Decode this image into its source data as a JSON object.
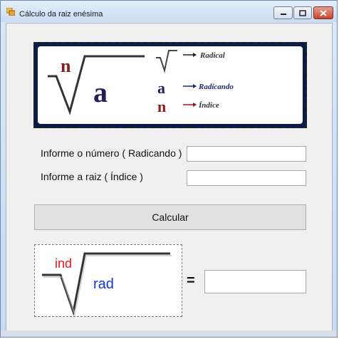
{
  "window": {
    "title": "Cálculo da raiz enésima",
    "controls": {
      "minimize": "minimize",
      "maximize": "maximize",
      "close": "close"
    }
  },
  "banner": {
    "index_letter": "n",
    "radicand_letter": "a",
    "legend": [
      {
        "label": "Radical"
      },
      {
        "label": "Radicando",
        "symbol": "a"
      },
      {
        "label": "Índice",
        "symbol": "n"
      }
    ]
  },
  "form": {
    "radicando_label": "Informe o número ( Radicando )",
    "radicando_value": "",
    "indice_label": "Informe a raiz ( Índice )",
    "indice_value": "",
    "calc_button": "Calcular"
  },
  "formula": {
    "index_text": "ind",
    "radicand_text": "rad",
    "equals": "=",
    "result_value": ""
  },
  "colors": {
    "index": "#e01515",
    "radicand": "#1537d4",
    "banner_dark": "#2a1a5e",
    "banner_red": "#8e1c1c"
  }
}
